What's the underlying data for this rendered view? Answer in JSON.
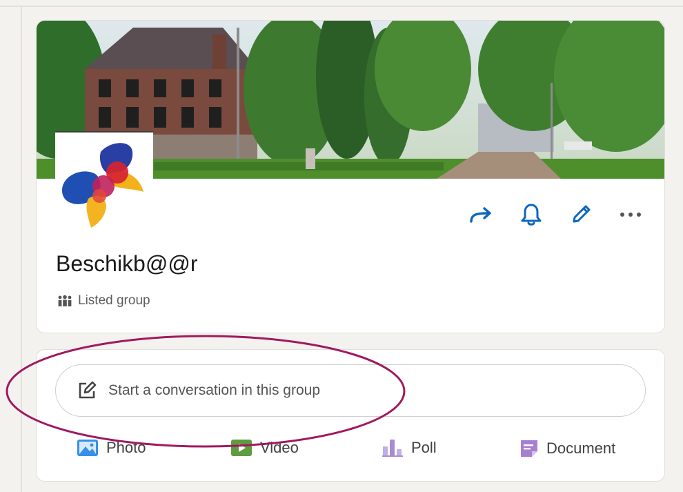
{
  "group": {
    "name": "Beschikb@@r",
    "type_label": "Listed group"
  },
  "actions": [
    {
      "icon": "share-icon"
    },
    {
      "icon": "bell-icon"
    },
    {
      "icon": "pencil-icon"
    },
    {
      "icon": "more-icon"
    }
  ],
  "composer": {
    "placeholder": "Start a conversation in this group",
    "icon": "edit-icon"
  },
  "media": {
    "photo": "Photo",
    "video": "Video",
    "poll": "Poll",
    "document": "Document"
  },
  "colors": {
    "accent": "#0a66c2",
    "annotation": "#a0195f",
    "photo": "#378fe9",
    "video": "#5f9b41",
    "poll": "#a98bd4",
    "document": "#a87fd0"
  }
}
